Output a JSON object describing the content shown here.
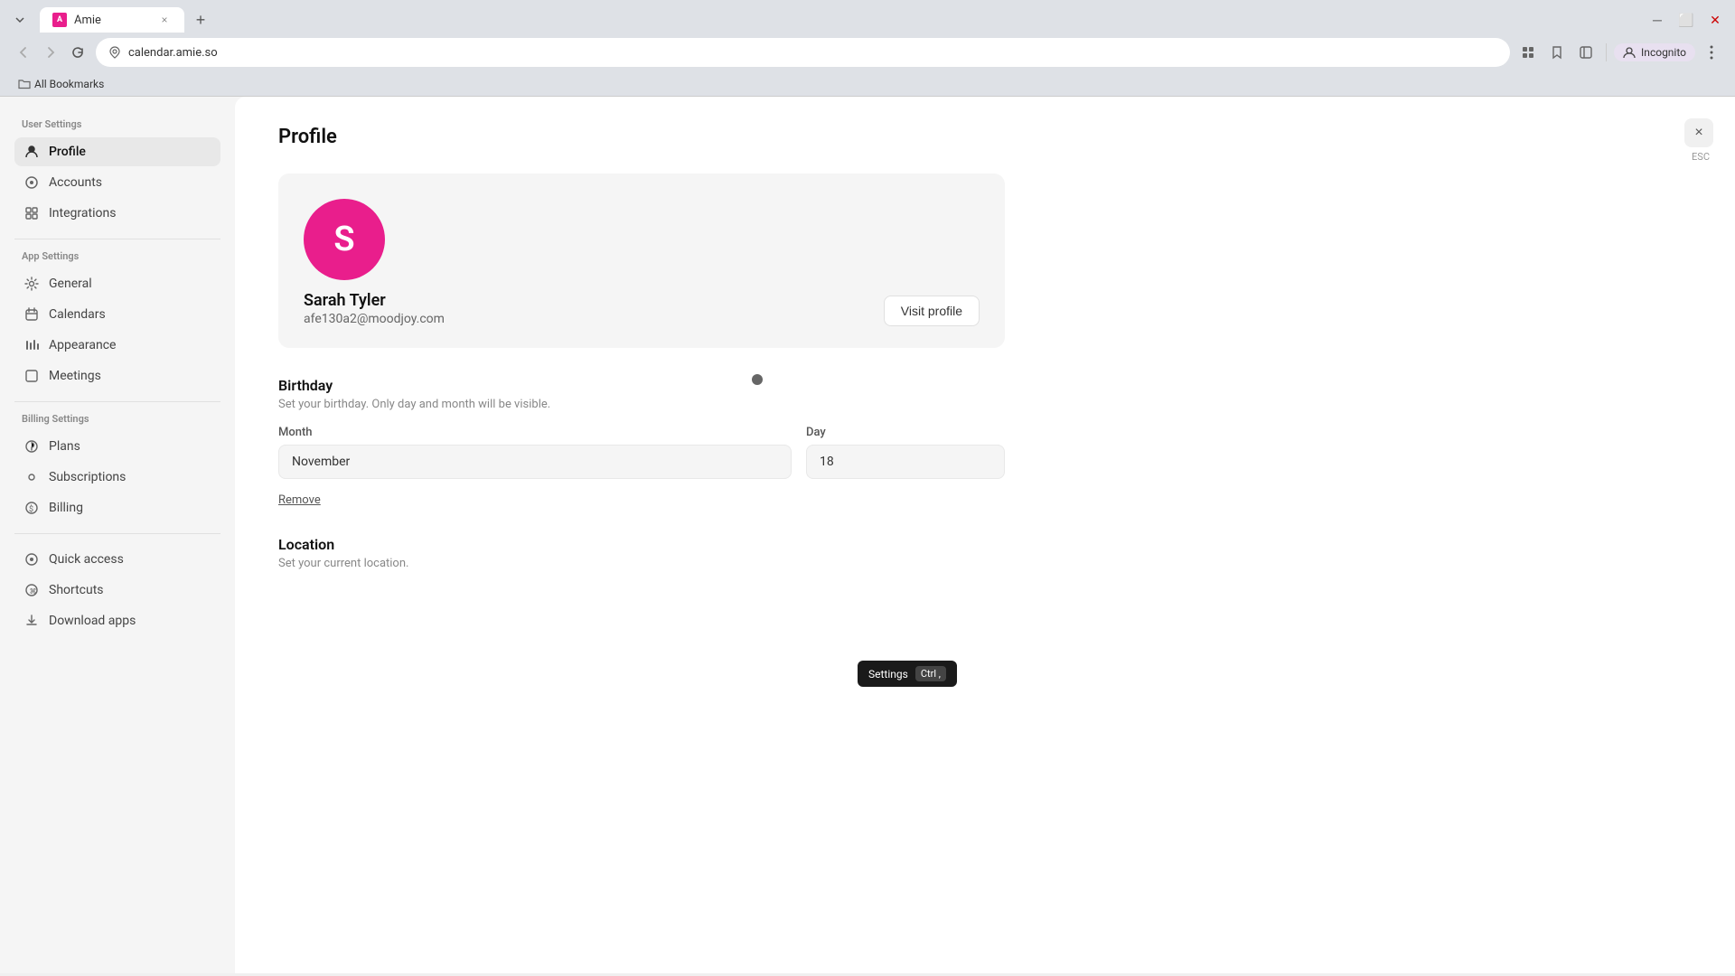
{
  "browser": {
    "tab": {
      "favicon_text": "A",
      "title": "Amie",
      "close_label": "×",
      "new_tab_label": "+"
    },
    "address": "calendar.amie.so",
    "nav": {
      "back": "←",
      "forward": "→",
      "refresh": "↻",
      "location_icon": "📍",
      "extensions_icon": "🧩",
      "bookmark_icon": "☆",
      "sidebar_icon": "⬜",
      "profile_label": "Incognito",
      "menu_icon": "⋮"
    },
    "bookmarks": {
      "folder_icon": "📁",
      "label": "All Bookmarks"
    }
  },
  "sidebar": {
    "user_settings_label": "User Settings",
    "items_user": [
      {
        "id": "profile",
        "label": "Profile",
        "icon": "person",
        "active": true
      },
      {
        "id": "accounts",
        "label": "Accounts",
        "icon": "circle"
      },
      {
        "id": "integrations",
        "label": "Integrations",
        "icon": "grid"
      }
    ],
    "app_settings_label": "App Settings",
    "items_app": [
      {
        "id": "general",
        "label": "General",
        "icon": "gear"
      },
      {
        "id": "calendars",
        "label": "Calendars",
        "icon": "calendar"
      },
      {
        "id": "appearance",
        "label": "Appearance",
        "icon": "bars"
      },
      {
        "id": "meetings",
        "label": "Meetings",
        "icon": "square"
      }
    ],
    "billing_settings_label": "Billing Settings",
    "items_billing": [
      {
        "id": "plans",
        "label": "Plans",
        "icon": "circle-gear"
      },
      {
        "id": "subscriptions",
        "label": "Subscriptions",
        "icon": "circle-small"
      },
      {
        "id": "billing",
        "label": "Billing",
        "icon": "dollar"
      }
    ],
    "items_other": [
      {
        "id": "quick-access",
        "label": "Quick access",
        "icon": "circle-q"
      },
      {
        "id": "shortcuts",
        "label": "Shortcuts",
        "icon": "circle-s"
      },
      {
        "id": "download-apps",
        "label": "Download apps",
        "icon": "download"
      }
    ]
  },
  "main": {
    "title": "Profile",
    "close_button": "×",
    "esc_label": "ESC",
    "profile_card": {
      "avatar_letter": "S",
      "name": "Sarah Tyler",
      "email": "afe130a2@moodjoy.com",
      "visit_profile_label": "Visit profile"
    },
    "birthday": {
      "title": "Birthday",
      "description": "Set your birthday. Only day and month will be visible.",
      "month_label": "Month",
      "month_value": "November",
      "day_label": "Day",
      "day_value": "18",
      "remove_label": "Remove"
    },
    "location": {
      "title": "Location",
      "description": "Set your current location."
    },
    "tooltip": {
      "label": "Settings",
      "shortcut": "Ctrl ,"
    }
  }
}
